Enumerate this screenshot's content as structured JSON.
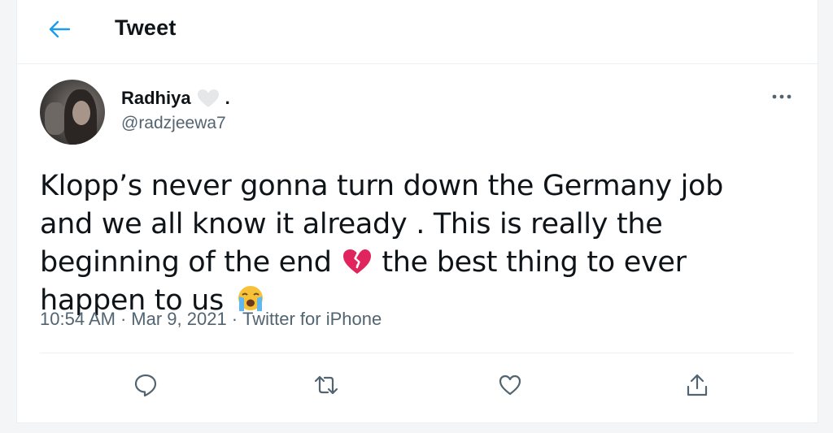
{
  "header": {
    "back_icon": "arrow-left-icon",
    "title": "Tweet"
  },
  "tweet": {
    "author": {
      "display_name": "Radhiya",
      "name_suffix": ".",
      "badge_icon": "white-heart-icon",
      "handle": "@radzjeewa7"
    },
    "text_parts": [
      "Klopp’s never gonna turn down the Germany job and we all know it already . This is really the beginning of the end",
      "the best thing to ever happen to us"
    ],
    "emojis": [
      "broken-heart-emoji",
      "loudly-crying-face-emoji"
    ],
    "time": "10:54 AM",
    "separator": "·",
    "date": "Mar 9, 2021",
    "source": "Twitter for iPhone"
  },
  "actions": [
    "reply-icon",
    "retweet-icon",
    "like-icon",
    "share-icon"
  ],
  "colors": {
    "accent": "#1d9bf0",
    "text": "#0f1419",
    "muted": "#536471",
    "icon": "#536471",
    "broken_heart": "#e0245e",
    "white_heart": "#e6e7e8"
  }
}
